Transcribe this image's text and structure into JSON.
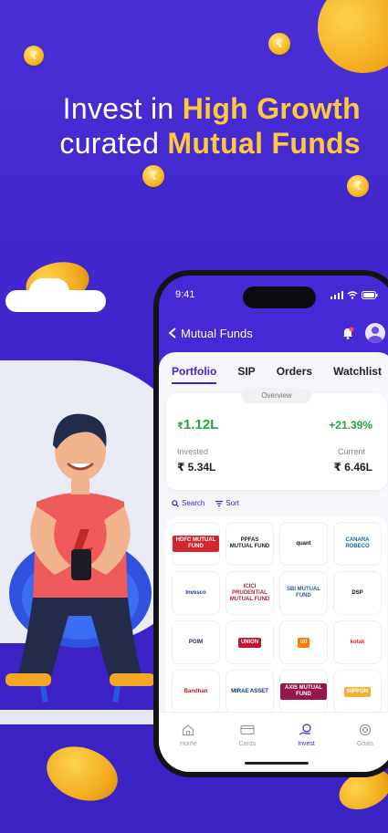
{
  "promo": {
    "line1_prefix": "Invest in ",
    "line1_highlight": "High Growth",
    "line2_prefix": "curated ",
    "line2_highlight": "Mutual Funds",
    "coin_symbol": "₹",
    "accent_color": "#ffc93c",
    "bg_color": "#3d23c9"
  },
  "status_bar": {
    "time": "9:41"
  },
  "app_bar": {
    "back_icon": "chevron-left-icon",
    "title": "Mutual Funds"
  },
  "tabs": [
    {
      "label": "Portfolio",
      "active": true
    },
    {
      "label": "SIP",
      "active": false
    },
    {
      "label": "Orders",
      "active": false
    },
    {
      "label": "Watchlist",
      "active": false
    }
  ],
  "overview": {
    "pill": "Overview",
    "currency": "₹",
    "returns": "1.12L",
    "returns_pct": "+21.39%",
    "invested_label": "Invested",
    "invested_value": "₹ 5.34L",
    "current_label": "Current",
    "current_value": "₹ 6.46L"
  },
  "tools": {
    "search": "Search",
    "sort": "Sort"
  },
  "amc_logos": [
    {
      "text": "HDFC MUTUAL FUND",
      "color": "#d22630",
      "bg": "#d22630",
      "fg": "#ffffff"
    },
    {
      "text": "PPFAS MUTUAL FUND",
      "color": "#1a1a1a",
      "bg": "#ffffff",
      "fg": "#1a1a1a"
    },
    {
      "text": "quant",
      "color": "#111111",
      "bg": "#ffffff",
      "fg": "#111111"
    },
    {
      "text": "CANARA ROBECO",
      "color": "#0a6aa8",
      "bg": "#ffffff",
      "fg": "#0a6aa8"
    },
    {
      "text": "Invesco",
      "color": "#1b3d8f",
      "bg": "#ffffff",
      "fg": "#1b3d8f"
    },
    {
      "text": "ICICI PRUDENTIAL MUTUAL FUND",
      "color": "#a5282d",
      "bg": "#ffffff",
      "fg": "#a5282d"
    },
    {
      "text": "SBI MUTUAL FUND",
      "color": "#2b58a8",
      "bg": "#ffffff",
      "fg": "#2b58a8"
    },
    {
      "text": "DSP",
      "color": "#111111",
      "bg": "#ffffff",
      "fg": "#111111"
    },
    {
      "text": "PGIM",
      "color": "#1c2a4a",
      "bg": "#ffffff",
      "fg": "#1c2a4a"
    },
    {
      "text": "UNION",
      "color": "#c8102e",
      "bg": "#c8102e",
      "fg": "#ffffff"
    },
    {
      "text": "uti",
      "color": "#ff7a00",
      "bg": "#ff7a00",
      "fg": "#ffffff"
    },
    {
      "text": "kotak",
      "color": "#e21b23",
      "bg": "#ffffff",
      "fg": "#e21b23"
    },
    {
      "text": "Bandhan",
      "color": "#b71c1c",
      "bg": "#ffffff",
      "fg": "#b71c1c"
    },
    {
      "text": "MIRAE ASSET",
      "color": "#0b3a7b",
      "bg": "#ffffff",
      "fg": "#0b3a7b"
    },
    {
      "text": "AXIS MUTUAL FUND",
      "color": "#97144d",
      "bg": "#97144d",
      "fg": "#ffffff"
    },
    {
      "text": "NIPPON",
      "color": "#e6a31e",
      "bg": "#f2b233",
      "fg": "#ffffff"
    }
  ],
  "bottom_nav": [
    {
      "label": "Home",
      "icon": "home-icon",
      "active": false
    },
    {
      "label": "Cards",
      "icon": "card-icon",
      "active": false
    },
    {
      "label": "Invest",
      "icon": "invest-icon",
      "active": true
    },
    {
      "label": "Goals",
      "icon": "goals-icon",
      "active": false
    }
  ]
}
